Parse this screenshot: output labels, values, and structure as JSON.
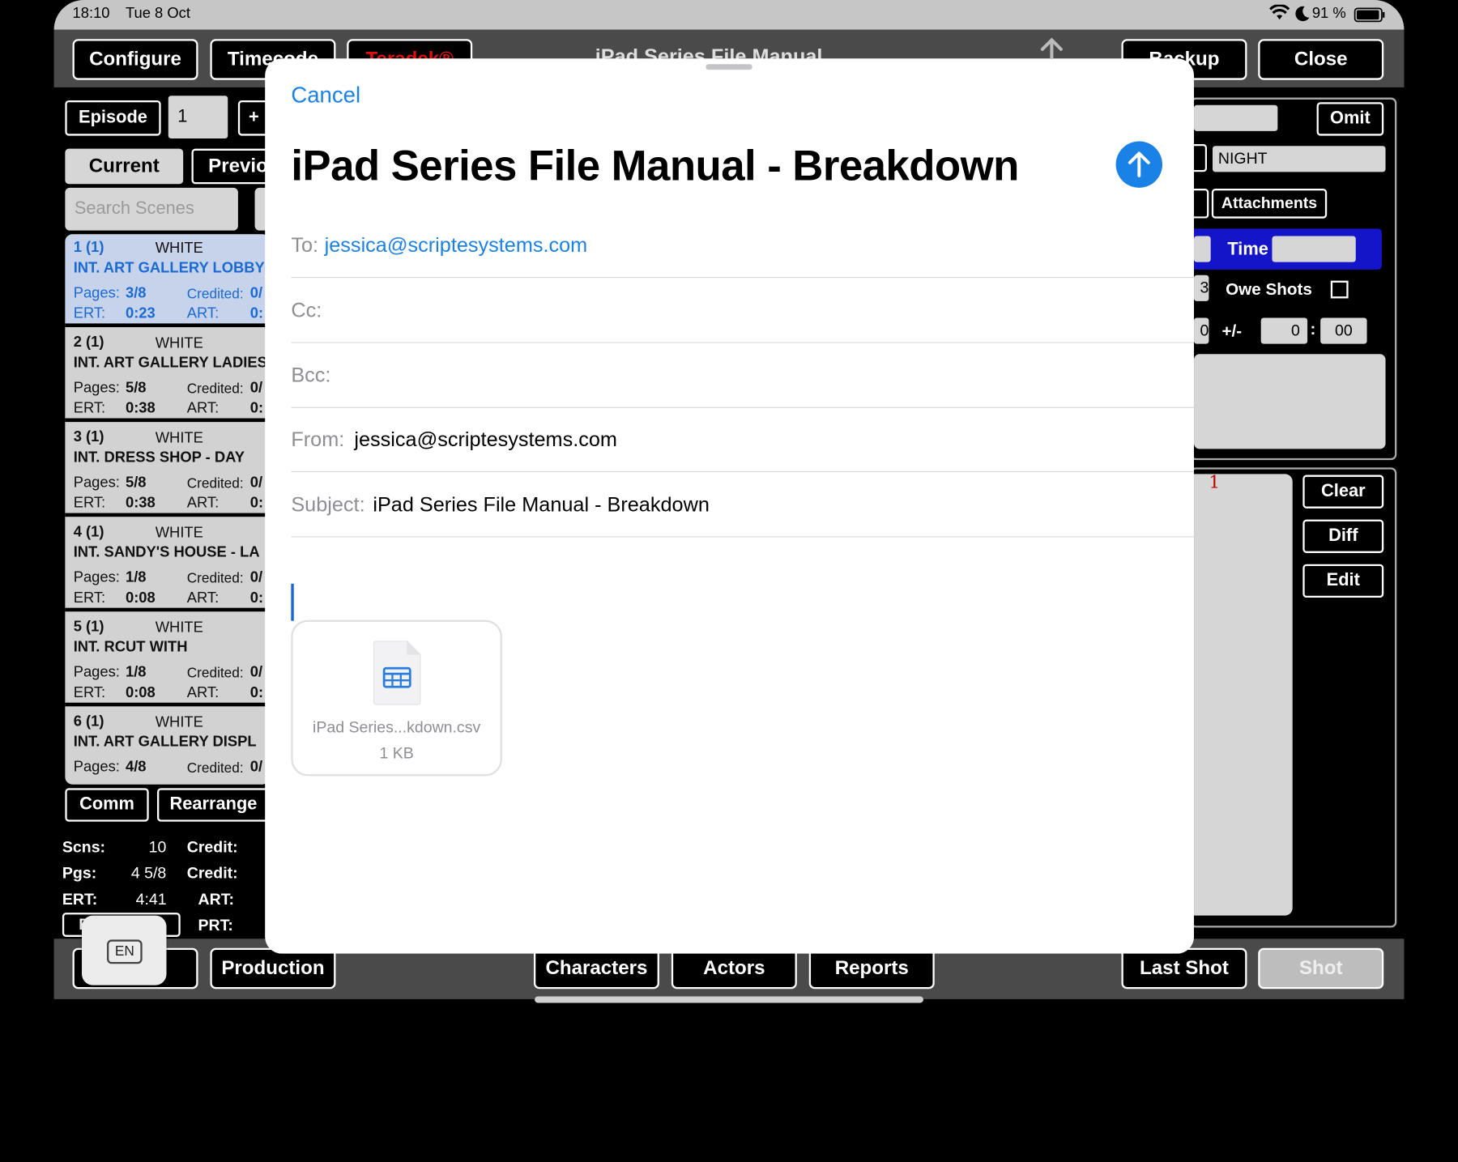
{
  "status": {
    "time": "18:10",
    "date": "Tue 8 Oct",
    "battery": "91 %",
    "icons": [
      "wifi-icon",
      "moon-icon",
      "battery-icon"
    ]
  },
  "app": {
    "title": "iPad Series File Manual",
    "top_buttons": {
      "configure": "Configure",
      "timecode": "Timecode",
      "teradek": "Teradek®",
      "backup": "Backup",
      "close": "Close"
    },
    "episode_label": "Episode",
    "episode_value": "1",
    "plus": "+",
    "tabs": {
      "current": "Current",
      "previous": "Previous"
    },
    "search_placeholder": "Search Scenes",
    "scenes": [
      {
        "num": "1 (1)",
        "color": "WHITE",
        "title": "INT. ART GALLERY LOBBY",
        "pages": "3/8",
        "ert": "0:23",
        "selected": true
      },
      {
        "num": "2 (1)",
        "color": "WHITE",
        "title": "INT. ART GALLERY LADIES",
        "pages": "5/8",
        "ert": "0:38",
        "selected": false
      },
      {
        "num": "3 (1)",
        "color": "WHITE",
        "title": "INT. DRESS SHOP - DAY",
        "pages": "5/8",
        "ert": "0:38",
        "selected": false
      },
      {
        "num": "4 (1)",
        "color": "WHITE",
        "title": "INT. SANDY'S HOUSE - LA",
        "pages": "1/8",
        "ert": "0:08",
        "selected": false
      },
      {
        "num": "5 (1)",
        "color": "WHITE",
        "title": "INT. RCUT WITH",
        "pages": "1/8",
        "ert": "0:08",
        "selected": false
      },
      {
        "num": "6 (1)",
        "color": "WHITE",
        "title": "INT. ART GALLERY DISPL",
        "pages": "4/8",
        "ert": "",
        "selected": false
      }
    ],
    "scene_labels": {
      "pages": "Pages:",
      "credited": "Credited:",
      "credited_val": "0/",
      "ert": "ERT:",
      "art": "ART:",
      "art_val": "0:"
    },
    "list_buttons": {
      "comm": "Comm",
      "rearrange": "Rearrange"
    },
    "stats": {
      "scns_label": "Scns:",
      "scns": "10",
      "pgs_label": "Pgs:",
      "pgs": "4 5/8",
      "ert_label": "ERT:",
      "ert": "4:41",
      "credit_label": "Credit:",
      "art_label": "ART:",
      "prt_label": "PRT:",
      "breakdown": "Breakdown"
    },
    "right": {
      "omit": "Omit",
      "night": "NIGHT",
      "attachments": "Attachments",
      "time": "Time",
      "owe_shots": "Owe Shots",
      "plus_minus": "+/-",
      "min": "0",
      "sec": "00",
      "colon": ":",
      "clear": "Clear",
      "diff": "Diff",
      "edit": "Edit",
      "note_num": "1",
      "partial_a": "3",
      "partial_b": "0"
    },
    "bottom_buttons": {
      "production": "Production",
      "characters": "Characters",
      "actors": "Actors",
      "reports": "Reports",
      "last_shot": "Last Shot",
      "shot": "Shot"
    },
    "keyboard_lang": "EN"
  },
  "mail": {
    "cancel": "Cancel",
    "title": "iPad Series File Manual - Breakdown",
    "to_label": "To:",
    "to": "jessica@scriptesystems.com",
    "cc_label": "Cc:",
    "bcc_label": "Bcc:",
    "from_label": "From:",
    "from": "jessica@scriptesystems.com",
    "subject_label": "Subject:",
    "subject": "iPad Series File Manual - Breakdown",
    "attachment": {
      "name": "iPad Series...kdown.csv",
      "size": "1 KB",
      "icon": "spreadsheet-icon"
    },
    "colors": {
      "accent": "#1a82e6",
      "send": "#1a82e6"
    }
  }
}
